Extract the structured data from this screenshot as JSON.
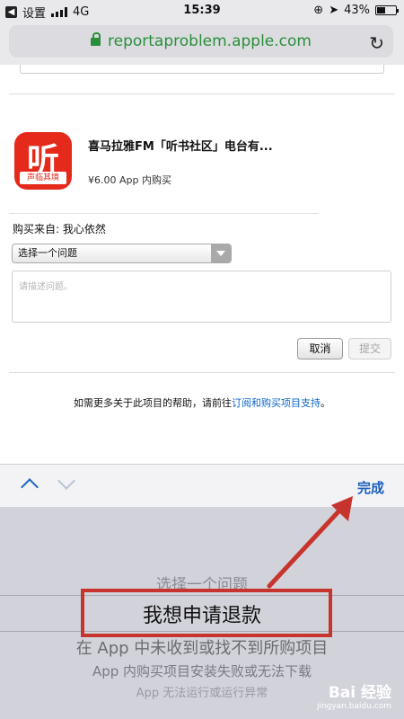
{
  "status_bar": {
    "back_label": "设置",
    "network": "4G",
    "time": "15:39",
    "battery": "43%",
    "battery_level": 0.43
  },
  "browser": {
    "url": "reportaproblem.apple.com"
  },
  "purchase": {
    "app_icon_glyph": "听",
    "app_icon_brand": "声临其境",
    "app_name": "喜马拉雅FM「听书社区」电台有...",
    "price_line": "¥6.00 App 内购买",
    "purchased_from": "购买来自: 我心依然"
  },
  "report_form": {
    "select_value": "选择一个问题",
    "textarea_placeholder": "请描述问题。",
    "cancel_label": "取消",
    "submit_label": "提交"
  },
  "help": {
    "text": "如需更多关于此项目的帮助，请前往",
    "link": "订阅和购买项目支持",
    "suffix": "。"
  },
  "toolbar": {
    "done_label": "完成"
  },
  "picker": {
    "options": [
      "选择一个问题",
      "我想申请退款",
      "在 App 中未收到或找不到所购项目",
      "App 内购买项目安装失败或无法下载",
      "App 无法运行或运行异常"
    ],
    "selected": "我想申请退款"
  },
  "watermark": {
    "text": "Bai 经验",
    "url": "jingyan.baidu.com"
  },
  "colors": {
    "annotation_red": "#c7342d",
    "link_blue": "#0b66c7",
    "url_green": "#2a8f3b"
  }
}
